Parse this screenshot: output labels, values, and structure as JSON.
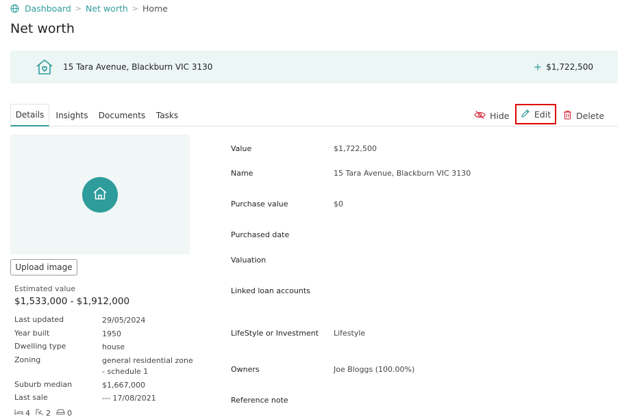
{
  "breadcrumb": {
    "items": [
      "Dashboard",
      "Net worth",
      "Home"
    ]
  },
  "page": {
    "title": "Net worth"
  },
  "asset": {
    "address": "15 Tara Avenue, Blackburn VIC 3130",
    "total": "$1,722,500"
  },
  "tabs": [
    {
      "label": "Details",
      "active": true
    },
    {
      "label": "Insights"
    },
    {
      "label": "Documents"
    },
    {
      "label": "Tasks"
    }
  ],
  "actions": {
    "hide": "Hide",
    "edit": "Edit",
    "delete": "Delete"
  },
  "upload": {
    "label": "Upload image"
  },
  "estimate": {
    "label": "Estimated value",
    "value": "$1,533,000 - $1,912,000"
  },
  "facts": [
    {
      "label": "Last updated",
      "value": "29/05/2024"
    },
    {
      "label": "Year built",
      "value": "1950"
    },
    {
      "label": "Dwelling type",
      "value": "house"
    },
    {
      "label": "Zoning",
      "value": "general residential zone - schedule 1"
    },
    {
      "label": "Suburb median",
      "value": "$1,667,000"
    },
    {
      "label": "Last sale",
      "value": "--- 17/08/2021"
    }
  ],
  "features": {
    "beds": "4",
    "baths": "2",
    "cars": "0"
  },
  "details": [
    {
      "label": "Value",
      "value": "$1,722,500"
    },
    {
      "label": "Name",
      "value": "15 Tara Avenue, Blackburn VIC 3130"
    },
    {
      "label": "Purchase value",
      "value": "$0"
    },
    {
      "label": "Purchased date",
      "value": ""
    },
    {
      "label": "Valuation",
      "value": ""
    },
    {
      "label": "Linked loan accounts",
      "value": ""
    },
    {
      "label": "LifeStyle or Investment",
      "value": "Lifestyle"
    },
    {
      "label": "Owners",
      "value": "Joe Bloggs (100.00%)"
    },
    {
      "label": "Reference note",
      "value": ""
    }
  ],
  "colors": {
    "accent": "#2e9c9b",
    "banner": "#ecf6f5",
    "highlight": "#e00000",
    "danger": "#d63a4a"
  }
}
